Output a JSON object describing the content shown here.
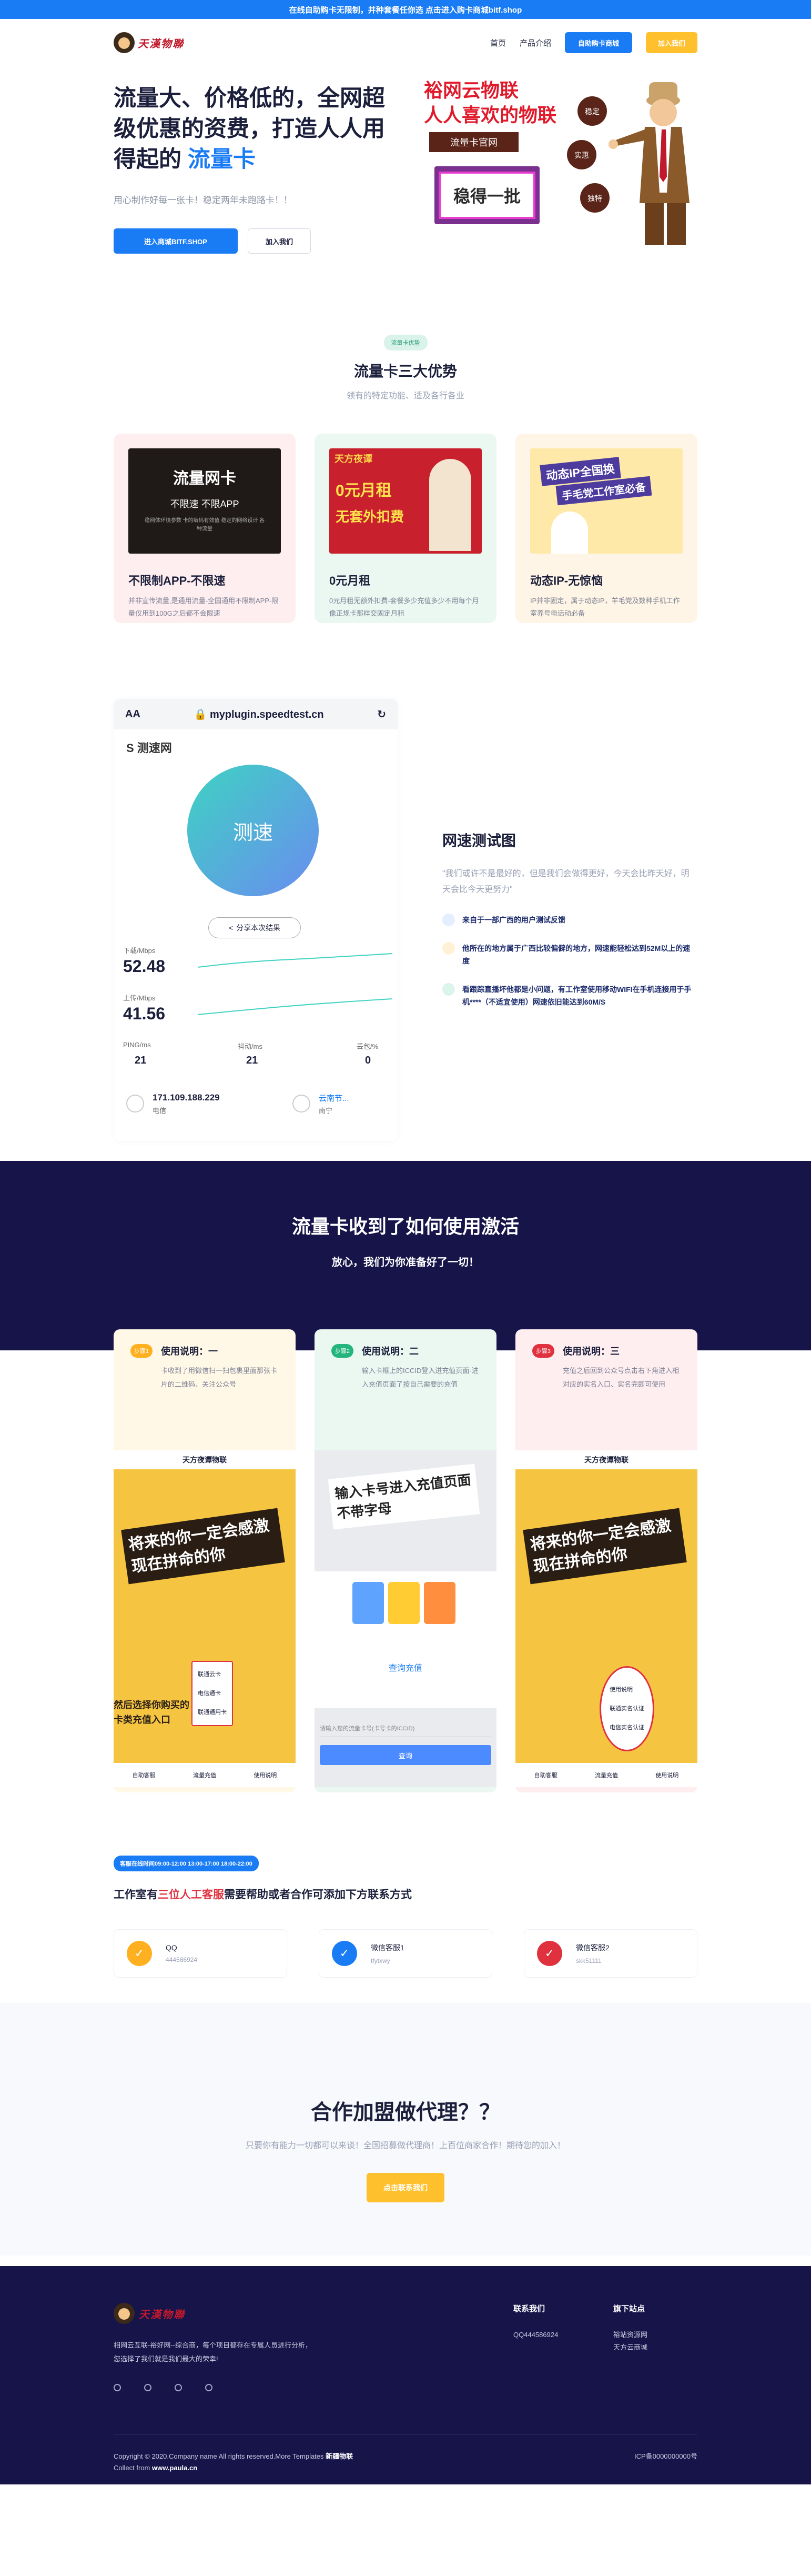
{
  "topbar": {
    "text": "在线自助购卡无限制，并种套餐任你选 点击进入购卡商城bitf.shop"
  },
  "header": {
    "logo_text": "天漢物聯",
    "nav": [
      "首页",
      "产品介绍"
    ],
    "shop_btn": "自助购卡商城",
    "join_btn": "加入我们"
  },
  "hero": {
    "title_main": "流量大、价格低的，全网超级优惠的资费，打造人人用得起的",
    "title_highlight": "流量卡",
    "subtitle": "用心制作好每一张卡！稳定两年未跑路卡！！",
    "btn_primary": "进入商城BITF.SHOP",
    "btn_secondary": "加入我们",
    "art": {
      "line1": "裕网云物联",
      "line2": "人人喜欢的物联",
      "badge": "流量卡官网",
      "stamp": "稳得一批",
      "tags": [
        "稳定",
        "实惠",
        "独特"
      ]
    }
  },
  "advantages": {
    "pill": "流量卡优势",
    "title": "流量卡三大优势",
    "subtitle": "领有的特定功能、适及各行各业",
    "cards": [
      {
        "img_title": "流量网卡",
        "img_sub": "不限速 不限APP",
        "img_note": "稳网体环境参数 卡的编码有效值 稳定的网络设计 各种流量",
        "title": "不限制APP-不限速",
        "desc": "并非宣传流量,是通用流量-全国通用不限制APP-限量仅用到100G之后都不会限速",
        "bg": "#ffeef0"
      },
      {
        "img_title": "天方夜谭",
        "img_sub": "0元月租",
        "img_note": "无套外扣费",
        "title": "0元月租",
        "desc": "0元月租无额外扣费-套餐多少充值多少不用每个月像正规卡那样交固定月租",
        "bg": "#eaf8f1"
      },
      {
        "img_title": "动态IP全国换",
        "img_sub": "手毛党工作室必备",
        "img_note": "",
        "title": "动态IP-无惊恼",
        "desc": "IP并非固定，属于动态IP，羊毛党及数种手机工作室养号电话动必备",
        "bg": "#fff5e6"
      }
    ]
  },
  "speedtest": {
    "url": "myplugin.speedtest.cn",
    "aa": "AA",
    "brand": "测速网",
    "circle": "测速",
    "share": "分享本次结果",
    "down_label": "下载/Mbps",
    "down_value": "52.48",
    "up_label": "上传/Mbps",
    "up_value": "41.56",
    "ping_label": "PING/ms",
    "ping_value": "21",
    "jitter_label": "抖动/ms",
    "jitter_value": "21",
    "loss_label": "丢包/%",
    "loss_value": "0",
    "ip": "171.109.188.229",
    "isp": "电信",
    "node": "云南节...",
    "node_city": "南宁",
    "title": "网速测试图",
    "quote": "\"我们或许不是最好的，但是我们会做得更好，今天会比昨天好，明天会比今天更努力\"",
    "features": [
      {
        "text": "来自于一部广西的用户测试反馈",
        "color": "#1a7cf5"
      },
      {
        "text": "他所在的地方属于广西比较偏僻的地方，网速能轻松达到52M以上的速度",
        "color": "#ffb020"
      },
      {
        "text": "看跟踪直播坏他都是小问题，有工作室使用移动WIFI在手机连接用于手机****（不适宜使用）网速依旧能达到60M/S",
        "color": "#24b47e"
      }
    ]
  },
  "howto": {
    "title": "流量卡收到了如何使用激活",
    "subtitle": "放心，我们为你准备好了一切！",
    "steps": [
      {
        "badge": "步骤1",
        "title": "使用说明：一",
        "desc": "卡收到了用微信扫一扫包裹里面那张卡片的二维码、关注公众号",
        "bg": "#fff8e6",
        "badge_color": "#ffb020",
        "shot_title": "天方夜谭物联",
        "shot_text": "将来的你一定会感激现在拼命的你",
        "shot_extra": "然后选择你购买的卡类充值入口",
        "menu": [
          "联通云卡",
          "电信通卡",
          "联通通用卡"
        ],
        "footer": [
          "自助客服",
          "流量充值",
          "使用说明"
        ]
      },
      {
        "badge": "步骤2",
        "title": "使用说明：二",
        "desc": "输入卡框上的ICCID登入进充值页面-进入充值页面了按自己需要的充值",
        "bg": "#eaf8f1",
        "badge_color": "#24b47e",
        "shot_title": "天方夜谭物联",
        "shot_text": "输入卡号进入充值页面不带字母",
        "shot_extra": "查询充值",
        "menu": [
          "请输入您的流量卡号(卡号卡的ICCID)"
        ],
        "footer": [
          "查询"
        ]
      },
      {
        "badge": "步骤3",
        "title": "使用说明：三",
        "desc": "充值之后回到公众号点击右下角进入相对应的实名入口、实名完即可使用",
        "bg": "#ffeef0",
        "badge_color": "#e0313f",
        "shot_title": "天方夜谭物联",
        "shot_text": "将来的你一定会感激现在拼命的你",
        "shot_extra": "",
        "menu": [
          "使用说明",
          "联通实名认证",
          "电信实名认证"
        ],
        "footer": [
          "自助客服",
          "流量充值",
          "使用说明"
        ]
      }
    ]
  },
  "contact": {
    "tag": "客服在线时间09:00-12:00 13:00-17:00 18:00-22:00",
    "text_before": "工作室有",
    "text_red": "三位人工客服",
    "text_after": "需要帮助或者合作可添加下方联系方式",
    "cards": [
      {
        "label": "QQ",
        "value": "444586924",
        "color": "#ffb020"
      },
      {
        "label": "微信客服1",
        "value": "tfytxwy",
        "color": "#1a7cf5"
      },
      {
        "label": "微信客服2",
        "value": "skk51111",
        "color": "#e0313f"
      }
    ]
  },
  "join": {
    "title": "合作加盟做代理？？",
    "subtitle": "只要你有能力一切都可以来谈！全国招募做代理商！上百位商家合作！期待您的加入！",
    "button": "点击联系我们"
  },
  "footer": {
    "logo_text": "天漢物聯",
    "desc": "相网云互联-裕好网--综合商，每个项目都存在专属人员进行分析，您选择了我们就是我们最大的荣幸!",
    "col1_title": "联系我们",
    "col1_items": [
      "QQ444586924"
    ],
    "col2_title": "旗下站点",
    "col2_items": [
      "裕站资源网",
      "天方云商城"
    ],
    "copyright": "Copyright © 2020.Company name All rights reserved.More Templates",
    "copyright_bold": "新疆物联",
    "collect": "Collect from",
    "collect_site": "www.paula.cn",
    "icp": "ICP备0000000000号"
  }
}
